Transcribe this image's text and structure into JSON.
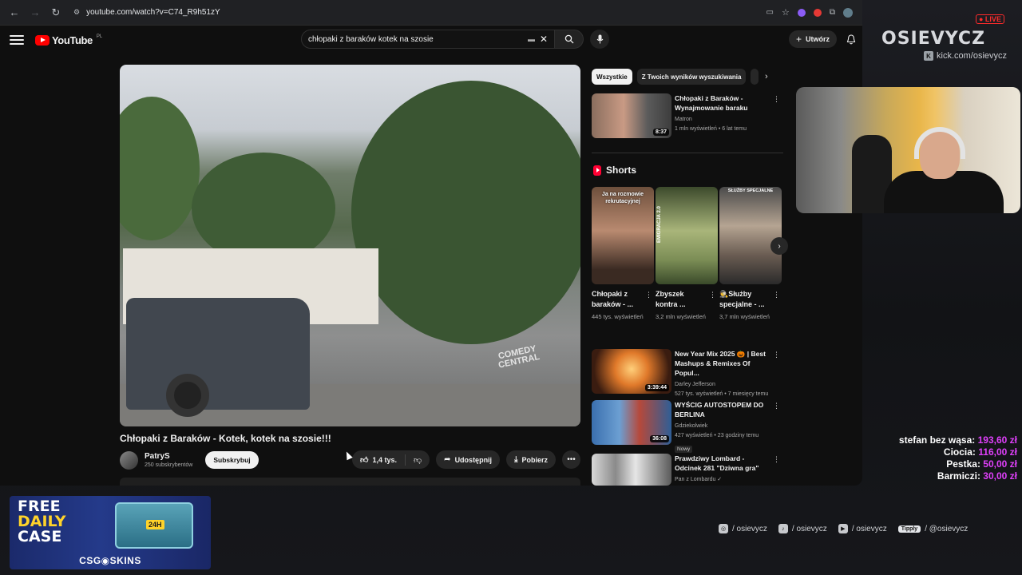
{
  "browser": {
    "url": "youtube.com/watch?v=C74_R9h51zY"
  },
  "youtube": {
    "logo_text": "YouTube",
    "region": "PL",
    "search_value": "chłopaki z baraków kotek na szosie",
    "create_label": "Utwórz"
  },
  "video": {
    "title": "Chłopaki z Baraków - Kotek, kotek na szosie!!!",
    "watermark": [
      "COMEDY",
      "CENTRAL"
    ],
    "channel_name": "PatryS",
    "channel_subs": "250 subskrybentów",
    "subscribe_label": "Subskrybuj",
    "likes": "1,4 tys.",
    "share_label": "Udostępnij",
    "download_label": "Pobierz"
  },
  "sidebar": {
    "chips": [
      "Wszystkie",
      "Z Twoich wyników wyszukiwania"
    ],
    "top_rec": {
      "title": "Chłopaki z Baraków - Wynajmowanie baraku",
      "channel": "Matron",
      "meta": "1 mln wyświetleń • 6 lat temu",
      "duration": "8:37"
    },
    "shorts_heading": "Shorts",
    "shorts": [
      {
        "title": "Chłopaki z baraków - ...",
        "views": "445 tys. wyświetleń",
        "caption": "Ja na rozmowie rekrutacyjnej"
      },
      {
        "title": "Zbyszek kontra ...",
        "views": "3,2 mln wyświetleń",
        "caption": "EMIGRACJA 2.0"
      },
      {
        "title": "🕵️Służby specjalne - ...",
        "views": "3,7 mln wyświetleń",
        "caption": "SŁUŻBY SPECJALNE"
      }
    ],
    "recs": [
      {
        "title": "New Year Mix 2025 🎃 | Best Mashups & Remixes Of Popul...",
        "channel": "Darley Jefferson",
        "meta": "527 tys. wyświetleń • 7 miesięcy temu",
        "duration": "3:39:44"
      },
      {
        "title": "WYŚCIG AUTOSTOPEM DO BERLINA",
        "channel": "Gdziekolwiek",
        "meta": "427 wyświetleń • 23 godziny temu",
        "badge": "Nowy",
        "duration": "36:08"
      },
      {
        "title": "Prawdziwy Lombard - Odcinek 281 \"Dziwna gra\"",
        "channel": "Pan z Lombardu ✓",
        "meta": "",
        "duration": ""
      }
    ]
  },
  "overlay": {
    "logo": "OSIEVYCZ",
    "live": "● LIVE",
    "kick_url": "kick.com/osievycz",
    "donations": [
      {
        "name": "stefan bez wąsa:",
        "amount": "193,60 zł"
      },
      {
        "name": "Ciocia:",
        "amount": "116,00 zł"
      },
      {
        "name": "Pestka:",
        "amount": "50,00 zł"
      },
      {
        "name": "Barmiczi:",
        "amount": "30,00 zł"
      }
    ],
    "socials": [
      "/ osievycz",
      "/ osievycz",
      "/ osievycz",
      "/ @osievycz"
    ],
    "tipply": "Tipply"
  },
  "ad": {
    "free": "FREE",
    "daily": "DAILY",
    "case": "CASE",
    "case_badge": "24H",
    "brand": "CSG◉SKINS"
  },
  "colors": {
    "youtube_red": "#ff0000",
    "donation_amount": "#e040fb",
    "live_red": "#ff2b2b"
  }
}
